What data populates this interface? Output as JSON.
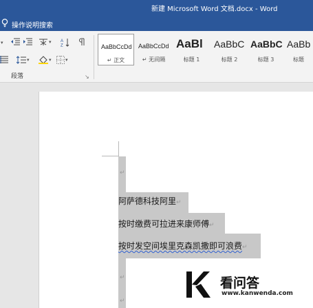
{
  "window": {
    "title": "新建 Microsoft Word 文档.docx  -  Word"
  },
  "tellme": {
    "label": "操作说明搜索"
  },
  "ribbon": {
    "paragraph_group_label": "段落",
    "launcher_glyph": "↘",
    "styles": [
      {
        "preview": "AaBbCcDd",
        "name": "↵ 正文"
      },
      {
        "preview": "AaBbCcDd",
        "name": "↵ 无间隔"
      },
      {
        "preview": "AaBl",
        "name": "标题 1"
      },
      {
        "preview": "AaBbC",
        "name": "标题 2"
      },
      {
        "preview": "AaBbC",
        "name": "标题 3"
      },
      {
        "preview": "AaBb",
        "name": "标题"
      }
    ]
  },
  "document": {
    "paragraphs": [
      {
        "text": "",
        "mark": "↵"
      },
      {
        "text": "阿萨德科技阿里",
        "mark": "↵"
      },
      {
        "text": "按时缴费可拉进来康师傅",
        "mark": "↵"
      },
      {
        "text": "按时发空间埃里克森凯撒即可浪费",
        "mark": "↵"
      },
      {
        "text": "",
        "mark": "↵"
      },
      {
        "text": "",
        "mark": "↵"
      }
    ],
    "highlight_color": "#c8c8c8"
  },
  "watermark": {
    "title": "看问答",
    "url": "www.kanwenda.com"
  },
  "colors": {
    "titlebar": "#2b579a",
    "ribbon": "#f3f3f3",
    "canvas": "#e6e6e6"
  }
}
